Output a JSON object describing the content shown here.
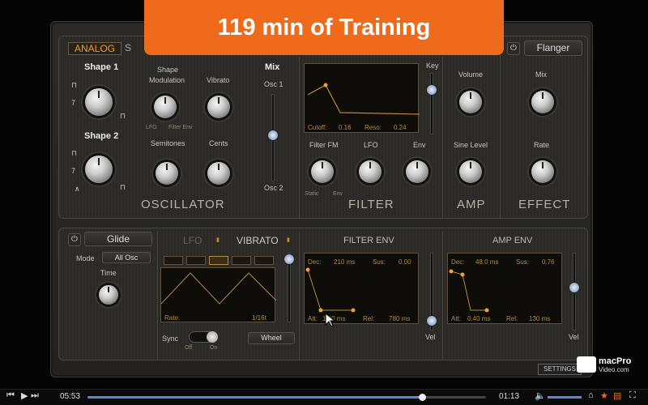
{
  "banner": {
    "text": "119 min of Training"
  },
  "oscillator": {
    "tab_label": "ANALOG",
    "tab_partial": "S",
    "shape1": "Shape 1",
    "shape2": "Shape 2",
    "shape_mod": "Shape",
    "shape_mod2": "Modulation",
    "vibrato": "Vibrato",
    "semitones": "Semitones",
    "cents": "Cents",
    "lfo_tag": "LFO",
    "filter_env_tag": "Filter Env",
    "mix": "Mix",
    "osc1": "Osc 1",
    "osc2": "Osc 2",
    "section_title": "OSCILLATOR",
    "num7a": "7",
    "num7b": "7"
  },
  "filter": {
    "key": "Key",
    "cutoff_label": "Cutoff:",
    "cutoff_value": "0.16",
    "reso_label": "Reso:",
    "reso_value": "0.24",
    "filter_fm": "Filter FM",
    "lfo": "LFO",
    "env": "Env",
    "static_tag": "Static",
    "env_tag": "Env",
    "section_title": "FILTER"
  },
  "amp": {
    "volume": "Volume",
    "sine_level": "Sine Level",
    "section_title": "AMP"
  },
  "effect": {
    "name": "Flanger",
    "mix": "Mix",
    "rate": "Rate",
    "section_title": "EFFECT"
  },
  "glide": {
    "label": "Glide",
    "mode_label": "Mode",
    "mode_value": "All Osc",
    "time": "Time"
  },
  "lfo_panel": {
    "lfo_tab": "LFO",
    "vibrato_tab": "VIBRATO",
    "rate_label": "Rate:",
    "rate_value": "1/16t",
    "sync": "Sync",
    "off": "Off",
    "on": "On",
    "wheel": "Wheel"
  },
  "filter_env": {
    "title": "FILTER ENV",
    "dec_label": "Dec:",
    "dec_value": "210 ms",
    "sus_label": "Sus:",
    "sus_value": "0.00",
    "att_label": "Att:",
    "att_value": "1.00 ms",
    "rel_label": "Rel:",
    "rel_value": "780 ms",
    "vel": "Vel"
  },
  "amp_env": {
    "title": "AMP ENV",
    "dec_label": "Dec:",
    "dec_value": "48.0 ms",
    "sus_label": "Sus:",
    "sus_value": "0.76",
    "att_label": "Att:",
    "att_value": "0.40 ms",
    "rel_label": "Rel:",
    "rel_value": "130 ms",
    "vel": "Vel"
  },
  "footer": {
    "settings": "SETTINGS",
    "logo_line1": "macPro",
    "logo_line2": "Video.com",
    "elapsed": "05:53",
    "remaining": "01:13",
    "progress_fraction": 0.84
  },
  "colors": {
    "banner": "#f06a1c",
    "accent": "#ff9a1c",
    "progress": "#5b88d6"
  }
}
